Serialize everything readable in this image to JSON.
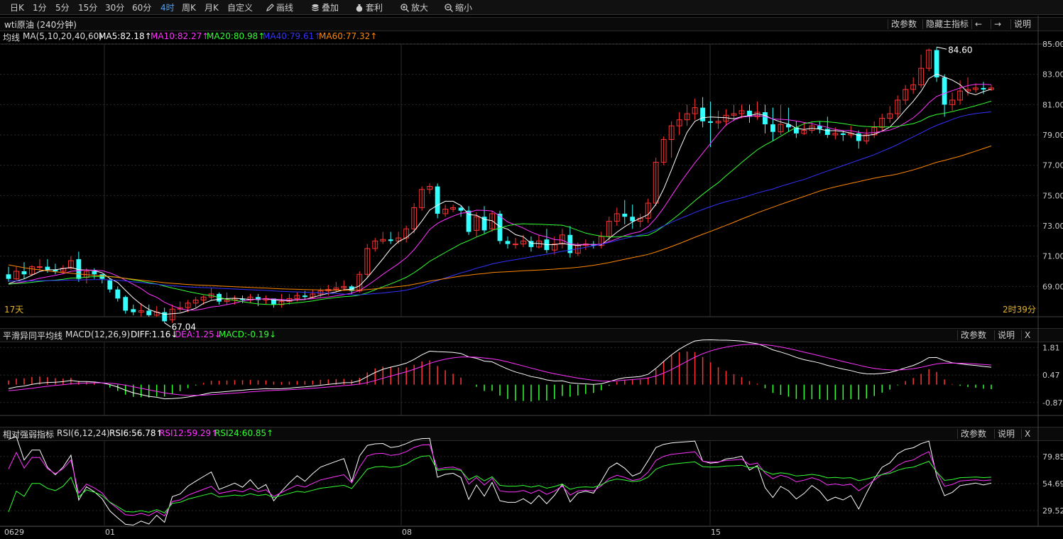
{
  "toolbar": {
    "items": [
      "日K",
      "1分",
      "5分",
      "15分",
      "30分",
      "60分",
      "4时",
      "周K",
      "月K",
      "自定义"
    ],
    "active_item": "4时",
    "tools": [
      {
        "label": "画线",
        "icon": "pencil-icon"
      },
      {
        "label": "叠加",
        "icon": "database-icon"
      },
      {
        "label": "套利",
        "icon": "money-bag-icon"
      },
      {
        "label": "放大",
        "icon": "zoom-in-icon"
      },
      {
        "label": "缩小",
        "icon": "zoom-out-icon"
      }
    ]
  },
  "main_pane": {
    "title": "wti原油 (240分钟)",
    "buttons": {
      "params": "改参数",
      "hide": "隐藏主指标",
      "prev": "←",
      "next": "→",
      "help": "说明"
    },
    "legend": {
      "prefix": "均线",
      "name": "MA(5,10,20,40,60)",
      "items": [
        {
          "text": "MA5:82.18↑",
          "color": "#ffffff"
        },
        {
          "text": "MA10:82.27↑",
          "color": "#ff33ff"
        },
        {
          "text": "MA20:80.98↑",
          "color": "#33ff33"
        },
        {
          "text": "MA40:79.61↑",
          "color": "#3333ff"
        },
        {
          "text": "MA60:77.32↑",
          "color": "#ff8800"
        }
      ]
    },
    "bottom_left": "17天",
    "bottom_right": "2时39分",
    "max_label": "84.60",
    "min_label": "67.04"
  },
  "macd_pane": {
    "legend": {
      "name": "平滑异同平均线",
      "params": "MACD(12,26,9)",
      "items": [
        {
          "text": "DIFF:1.16↓",
          "color": "#ffffff"
        },
        {
          "text": "DEA:1.25↓",
          "color": "#ff33ff"
        },
        {
          "text": "MACD:-0.19↓",
          "color": "#33ff33"
        }
      ]
    },
    "buttons": {
      "params": "改参数",
      "help": "说明",
      "close": "X"
    },
    "axis_ticks": [
      "1.81",
      "0.47",
      "-0.87"
    ]
  },
  "rsi_pane": {
    "legend": {
      "name": "相对强弱指标",
      "params": "RSI(6,12,24)",
      "items": [
        {
          "text": "RSI6:56.78↑",
          "color": "#ffffff"
        },
        {
          "text": "RSI12:59.29↑",
          "color": "#ff33ff"
        },
        {
          "text": "RSI24:60.85↑",
          "color": "#33ff33"
        }
      ]
    },
    "buttons": {
      "params": "改参数",
      "help": "说明",
      "close": "X"
    },
    "axis_ticks": [
      "79.85",
      "54.69",
      "29.52"
    ]
  },
  "date_axis": {
    "labels": [
      "0629",
      "01",
      "08",
      "15"
    ]
  },
  "colors": {
    "up": "#ff3333",
    "down": "#33ffff",
    "grid": "#2a2a2a",
    "separator": "#444"
  },
  "chart_data": {
    "type": "candlestick",
    "title": "wti原油 (240分钟)",
    "price_axis": {
      "ticks": [
        85,
        83,
        81,
        79,
        77,
        75,
        73,
        71,
        69
      ],
      "ylim": [
        67,
        85
      ]
    },
    "x_dates": [
      "0629",
      "01",
      "08",
      "15"
    ],
    "candles": [
      [
        69.8,
        69.5,
        70.3,
        69.3
      ],
      [
        69.5,
        70.0,
        70.3,
        69.4
      ],
      [
        70.0,
        69.8,
        70.6,
        69.5
      ],
      [
        69.8,
        70.3,
        70.4,
        69.7
      ],
      [
        70.3,
        70.3,
        70.8,
        70.0
      ],
      [
        70.3,
        70.1,
        70.8,
        69.9
      ],
      [
        70.1,
        70.0,
        70.5,
        69.8
      ],
      [
        70.0,
        70.2,
        70.4,
        69.8
      ],
      [
        70.2,
        70.7,
        71.0,
        70.1
      ],
      [
        70.8,
        69.5,
        71.3,
        69.3
      ],
      [
        69.6,
        70.0,
        70.2,
        69.2
      ],
      [
        70.0,
        69.8,
        70.2,
        69.5
      ],
      [
        69.8,
        69.5,
        69.8,
        69.2
      ],
      [
        69.4,
        68.8,
        69.5,
        68.6
      ],
      [
        68.8,
        68.2,
        69.0,
        68.0
      ],
      [
        68.3,
        67.4,
        68.4,
        67.2
      ],
      [
        67.5,
        67.3,
        67.8,
        67.1
      ],
      [
        67.3,
        67.4,
        67.9,
        67.0
      ],
      [
        67.4,
        67.1,
        67.8,
        67.0
      ],
      [
        67.1,
        67.3,
        67.7,
        67.0
      ],
      [
        67.3,
        66.7,
        67.6,
        66.6
      ],
      [
        66.8,
        67.5,
        67.8,
        66.6
      ],
      [
        67.5,
        67.6,
        68.0,
        67.3
      ],
      [
        67.6,
        67.9,
        68.1,
        67.3
      ],
      [
        67.9,
        68.1,
        68.3,
        67.6
      ],
      [
        68.1,
        68.3,
        68.4,
        67.8
      ],
      [
        68.3,
        68.5,
        68.9,
        68.1
      ],
      [
        68.5,
        68.0,
        68.6,
        67.8
      ],
      [
        68.0,
        68.1,
        68.6,
        67.8
      ],
      [
        68.1,
        68.2,
        68.4,
        67.8
      ],
      [
        68.2,
        68.1,
        68.4,
        67.9
      ],
      [
        68.1,
        68.3,
        68.5,
        67.9
      ],
      [
        68.3,
        68.1,
        68.5,
        67.7
      ],
      [
        68.1,
        68.2,
        68.4,
        67.8
      ],
      [
        68.2,
        67.8,
        68.2,
        67.6
      ],
      [
        67.8,
        68.0,
        68.5,
        67.6
      ],
      [
        68.0,
        68.2,
        68.5,
        67.8
      ],
      [
        68.2,
        68.4,
        68.6,
        68.0
      ],
      [
        68.4,
        68.3,
        68.7,
        68.1
      ],
      [
        68.3,
        68.5,
        68.8,
        68.2
      ],
      [
        68.5,
        68.7,
        68.9,
        68.3
      ],
      [
        68.7,
        68.8,
        69.1,
        68.4
      ],
      [
        68.8,
        68.9,
        69.3,
        68.6
      ],
      [
        68.9,
        69.0,
        69.4,
        68.7
      ],
      [
        69.0,
        68.7,
        69.1,
        68.5
      ],
      [
        68.7,
        69.8,
        70.0,
        68.6
      ],
      [
        69.8,
        71.5,
        71.8,
        69.6
      ],
      [
        71.5,
        72.0,
        72.2,
        71.3
      ],
      [
        72.0,
        72.1,
        72.6,
        71.8
      ],
      [
        72.1,
        72.0,
        72.6,
        71.8
      ],
      [
        72.0,
        72.2,
        72.6,
        71.8
      ],
      [
        72.2,
        72.8,
        73.0,
        71.9
      ],
      [
        72.8,
        74.2,
        74.5,
        72.5
      ],
      [
        74.2,
        75.4,
        75.6,
        74.0
      ],
      [
        75.4,
        75.6,
        75.8,
        75.1
      ],
      [
        75.6,
        73.8,
        75.8,
        73.5
      ],
      [
        73.8,
        74.1,
        74.4,
        73.6
      ],
      [
        74.1,
        74.2,
        74.4,
        73.9
      ],
      [
        74.2,
        74.0,
        74.3,
        73.6
      ],
      [
        74.0,
        72.6,
        74.3,
        72.4
      ],
      [
        72.7,
        73.6,
        73.9,
        72.3
      ],
      [
        73.6,
        72.7,
        74.3,
        72.5
      ],
      [
        72.8,
        73.8,
        74.0,
        72.6
      ],
      [
        73.8,
        72.0,
        74.0,
        71.8
      ],
      [
        72.0,
        71.8,
        72.3,
        71.5
      ],
      [
        71.8,
        71.8,
        72.2,
        71.5
      ],
      [
        71.8,
        72.0,
        72.4,
        71.6
      ],
      [
        72.0,
        71.6,
        72.3,
        71.3
      ],
      [
        71.6,
        72.0,
        72.4,
        71.5
      ],
      [
        72.1,
        71.4,
        72.8,
        71.2
      ],
      [
        71.4,
        71.8,
        72.3,
        71.1
      ],
      [
        71.8,
        72.4,
        72.8,
        71.5
      ],
      [
        72.4,
        71.2,
        73.0,
        70.9
      ],
      [
        71.2,
        71.7,
        71.9,
        71.0
      ],
      [
        71.7,
        71.8,
        72.1,
        71.4
      ],
      [
        71.8,
        71.7,
        72.0,
        71.5
      ],
      [
        71.7,
        72.3,
        72.6,
        71.5
      ],
      [
        72.3,
        73.3,
        73.6,
        72.0
      ],
      [
        73.3,
        73.8,
        74.2,
        73.0
      ],
      [
        73.8,
        73.6,
        74.7,
        73.1
      ],
      [
        73.6,
        73.3,
        74.4,
        72.8
      ],
      [
        73.3,
        73.5,
        73.8,
        72.9
      ],
      [
        73.5,
        74.5,
        74.8,
        73.2
      ],
      [
        74.5,
        77.2,
        77.5,
        74.3
      ],
      [
        77.2,
        78.7,
        78.9,
        77.0
      ],
      [
        78.7,
        79.6,
        79.9,
        77.5
      ],
      [
        79.6,
        80.0,
        80.5,
        79.0
      ],
      [
        80.0,
        80.4,
        81.0,
        79.6
      ],
      [
        80.4,
        80.8,
        81.4,
        80.0
      ],
      [
        80.8,
        79.9,
        81.5,
        79.5
      ],
      [
        79.9,
        79.8,
        81.2,
        78.2
      ],
      [
        79.8,
        79.9,
        80.6,
        79.4
      ],
      [
        79.9,
        80.3,
        80.7,
        79.6
      ],
      [
        80.3,
        80.4,
        81.0,
        79.9
      ],
      [
        80.4,
        80.6,
        81.0,
        80.1
      ],
      [
        80.6,
        80.2,
        81.0,
        79.8
      ],
      [
        80.2,
        80.5,
        81.2,
        80.0
      ],
      [
        80.5,
        79.7,
        81.0,
        79.1
      ],
      [
        79.7,
        79.2,
        80.8,
        78.6
      ],
      [
        79.2,
        79.7,
        81.0,
        79.0
      ],
      [
        79.7,
        79.5,
        80.8,
        79.2
      ],
      [
        79.5,
        79.1,
        79.9,
        78.8
      ],
      [
        79.1,
        79.3,
        79.8,
        79.0
      ],
      [
        79.3,
        79.6,
        79.9,
        79.1
      ],
      [
        79.6,
        79.4,
        79.9,
        79.1
      ],
      [
        79.4,
        79.0,
        80.2,
        78.8
      ],
      [
        79.0,
        79.1,
        79.5,
        78.7
      ],
      [
        79.1,
        79.0,
        79.3,
        78.6
      ],
      [
        79.0,
        79.1,
        79.6,
        78.8
      ],
      [
        79.1,
        78.6,
        79.3,
        78.1
      ],
      [
        78.6,
        79.0,
        79.4,
        78.4
      ],
      [
        79.0,
        79.5,
        79.9,
        78.8
      ],
      [
        79.5,
        80.1,
        80.4,
        79.2
      ],
      [
        80.1,
        80.4,
        80.9,
        79.8
      ],
      [
        80.4,
        81.3,
        81.6,
        80.1
      ],
      [
        81.3,
        82.0,
        82.3,
        81.0
      ],
      [
        82.0,
        82.3,
        82.8,
        81.7
      ],
      [
        82.3,
        83.4,
        84.3,
        82.1
      ],
      [
        83.4,
        84.6,
        84.7,
        83.2
      ],
      [
        84.6,
        82.8,
        84.8,
        82.5
      ],
      [
        82.8,
        81.0,
        83.0,
        80.2
      ],
      [
        81.0,
        81.3,
        81.8,
        80.6
      ],
      [
        81.3,
        81.9,
        82.6,
        81.0
      ],
      [
        81.9,
        82.0,
        82.8,
        81.6
      ],
      [
        82.0,
        82.1,
        82.4,
        81.8
      ],
      [
        82.1,
        82.0,
        82.5,
        81.7
      ],
      [
        82.0,
        82.1,
        82.3,
        81.9
      ]
    ],
    "ma_series": [
      "MA5",
      "MA10",
      "MA20",
      "MA40",
      "MA60"
    ],
    "macd_ylim": [
      -1.5,
      2.1
    ],
    "rsi_ylim": [
      15,
      95
    ]
  }
}
